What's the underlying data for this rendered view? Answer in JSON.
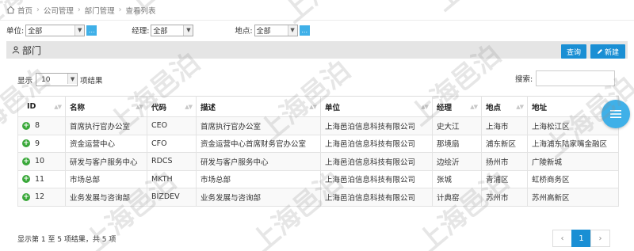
{
  "breadcrumb": {
    "items": [
      "首页",
      "公司管理",
      "部门管理",
      "查看列表"
    ]
  },
  "filters": [
    {
      "label": "单位:",
      "value": "全部"
    },
    {
      "label": "经理:",
      "value": "全部"
    },
    {
      "label": "地点:",
      "value": "全部"
    }
  ],
  "panel": {
    "title": "部门",
    "query_label": "查询",
    "new_label": "新建"
  },
  "length": {
    "prefix": "显示",
    "value": "10",
    "suffix": "项结果"
  },
  "search": {
    "label": "搜索:",
    "value": ""
  },
  "table": {
    "columns": [
      "ID",
      "名称",
      "代码",
      "描述",
      "单位",
      "经理",
      "地点",
      "地址"
    ],
    "rows": [
      [
        "8",
        "首席执行官办公室",
        "CEO",
        "首席执行官办公室",
        "上海邑泊信息科技有限公司",
        "史大江",
        "上海市",
        "上海松江区"
      ],
      [
        "9",
        "资金运营中心",
        "CFO",
        "资金运营中心首席财务官办公室",
        "上海邑泊信息科技有限公司",
        "那境扇",
        "浦东新区",
        "上海浦东陆家嘴金融区"
      ],
      [
        "10",
        "研发与客户服务中心",
        "RDCS",
        "研发与客户服务中心",
        "上海邑泊信息科技有限公司",
        "边绘沂",
        "扬州市",
        "广陵新城"
      ],
      [
        "11",
        "市场总部",
        "MKTH",
        "市场总部",
        "上海邑泊信息科技有限公司",
        "张城",
        "青浦区",
        "虹桥商务区"
      ],
      [
        "12",
        "业务发展与咨询部",
        "BIZDEV",
        "业务发展与咨询部",
        "上海邑泊信息科技有限公司",
        "计典窑",
        "苏州市",
        "苏州高新区"
      ]
    ]
  },
  "info": "显示第 1 至 5 项结果，共 5 项",
  "pagination": {
    "prev": "‹",
    "current": "1",
    "next": "›"
  },
  "watermark": "上海邑泊",
  "colors": {
    "accent": "#1a8fd4",
    "add_icon": "#3aa83a",
    "fab": "#3fb0e8"
  }
}
